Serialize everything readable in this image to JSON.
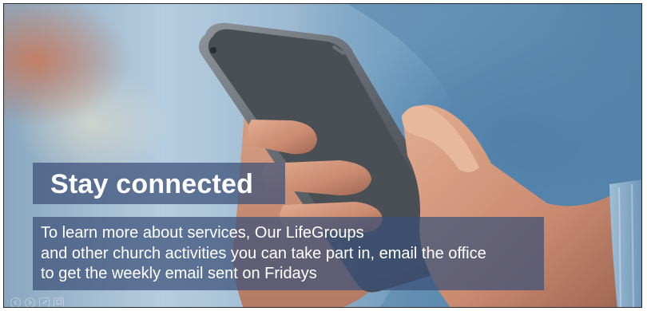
{
  "slide": {
    "title": "Stay connected",
    "body_lines": [
      "To learn more about services, Our LifeGroups",
      "and other church activities you can take part in, email the office",
      "to get the weekly email sent on Fridays"
    ],
    "background_image": "hands-holding-smartphone-photo"
  },
  "controls": {
    "icons": [
      "previous-slide-icon",
      "next-slide-icon",
      "pen-icon",
      "slides-menu-icon"
    ]
  },
  "colors": {
    "text_box": "#3c5078",
    "text": "#ffffff",
    "frame_border": "#2b2b2b"
  }
}
